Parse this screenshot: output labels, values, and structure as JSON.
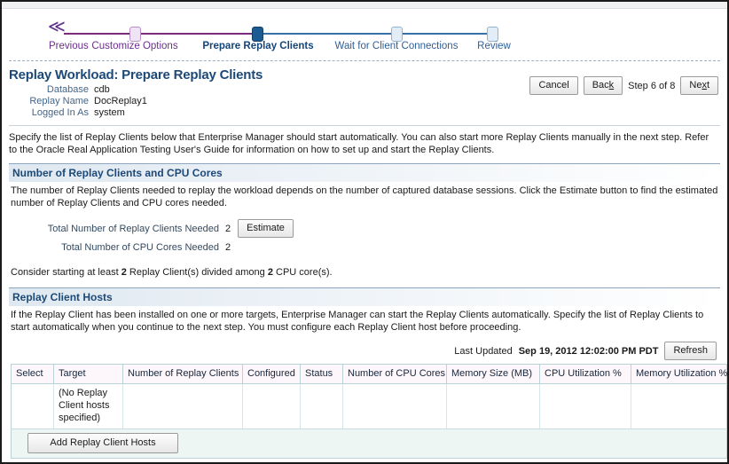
{
  "train": {
    "previous_label": "Previous",
    "previous_icon": "double-chevron-left-icon",
    "steps": [
      {
        "label": "Customize Options",
        "state": "visited"
      },
      {
        "label": "Prepare Replay Clients",
        "state": "current"
      },
      {
        "label": "Wait for Client Connections",
        "state": "future"
      },
      {
        "label": "Review",
        "state": "future"
      }
    ],
    "colors": {
      "visited": "#7b2b7b",
      "future": "#3a6fa8",
      "current_node": "#1c5a92"
    }
  },
  "header": {
    "title": "Replay Workload: Prepare Replay Clients",
    "fields": [
      {
        "label": "Database",
        "value": "cdb"
      },
      {
        "label": "Replay Name",
        "value": "DocReplay1"
      },
      {
        "label": "Logged In As",
        "value": "system"
      }
    ],
    "cancel_label": "Cancel",
    "back_label": "Back",
    "back_label_pre": "Bac",
    "back_label_accel": "k",
    "next_label_pre": "Ne",
    "next_label_accel": "x",
    "next_label_post": "t",
    "step_text": "Step 6 of 8"
  },
  "intro": {
    "text": "Specify the list of Replay Clients below that Enterprise Manager should start automatically. You can also start more Replay Clients manually in the next step.  Refer to the Oracle Real Application Testing User's Guide for information on how to set up and start the Replay Clients."
  },
  "clients_section": {
    "heading": "Number of Replay Clients and CPU Cores",
    "description": "The number of Replay Clients needed to replay the workload depends on the number of captured database sessions. Click the Estimate button to find the estimated number of Replay Clients and CPU cores needed.",
    "rows": [
      {
        "label": "Total Number of Replay Clients Needed",
        "value": "2"
      },
      {
        "label": "Total Number of CPU Cores Needed",
        "value": "2"
      }
    ],
    "estimate_label": "Estimate",
    "consider": {
      "prefix": "Consider starting at least ",
      "clients_count": "2",
      "middle": " Replay Client(s) divided among ",
      "cores_count": "2",
      "suffix": " CPU core(s)."
    }
  },
  "hosts_section": {
    "heading": "Replay Client Hosts",
    "description": "If the Replay Client has been installed on one or more targets, Enterprise Manager can start the Replay Clients automatically. Specify the list of Replay Clients to start automatically when you continue to the next step. You must configure each Replay Client host before proceeding.",
    "last_updated_label": "Last Updated",
    "last_updated_value": "Sep 19, 2012 12:02:00 PM PDT",
    "refresh_label": "Refresh",
    "table": {
      "columns": [
        "Select",
        "Target",
        "Number of Replay Clients",
        "Configured",
        "Status",
        "Number of CPU Cores",
        "Memory Size (MB)",
        "CPU Utilization %",
        "Memory Utilization %"
      ],
      "empty_message": "(No Replay Client hosts specified)"
    },
    "add_hosts_label": "Add Replay Client Hosts"
  }
}
